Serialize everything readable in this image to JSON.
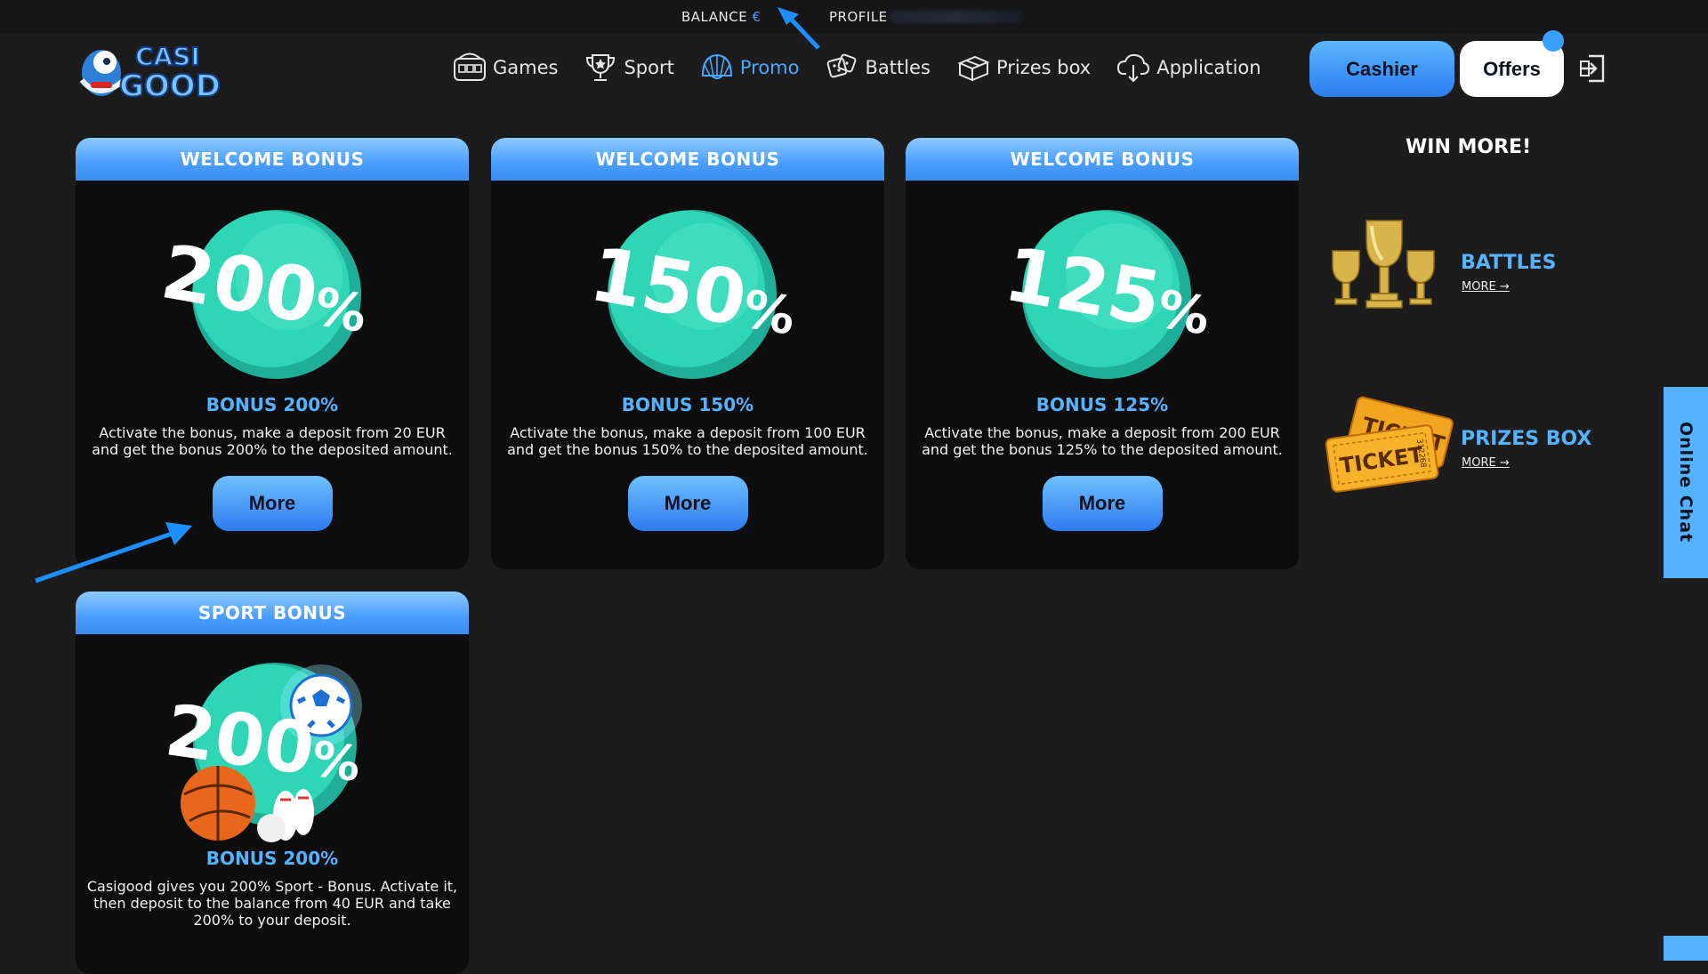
{
  "top_bar": {
    "balance_label": "BALANCE",
    "balance_currency": "€",
    "profile_label": "PROFILE"
  },
  "logo": {
    "alt": "CASI GOOD"
  },
  "nav": [
    {
      "label": "Games",
      "icon": "slot-machine-icon"
    },
    {
      "label": "Sport",
      "icon": "trophy-icon"
    },
    {
      "label": "Promo",
      "icon": "shell-icon",
      "active": true
    },
    {
      "label": "Battles",
      "icon": "dice-icon"
    },
    {
      "label": "Prizes box",
      "icon": "gift-box-icon"
    },
    {
      "label": "Application",
      "icon": "download-cloud-icon"
    }
  ],
  "header": {
    "cashier_label": "Cashier",
    "offers_label": "Offers"
  },
  "cards": [
    {
      "head": "WELCOME BONUS",
      "percent": "200",
      "title": "BONUS 200%",
      "desc_line1": "Activate the bonus, make a deposit from 20 EUR",
      "desc_line2": "and get the bonus 200% to the deposited amount.",
      "button": "More"
    },
    {
      "head": "WELCOME BONUS",
      "percent": "150",
      "title": "BONUS 150%",
      "desc_line1": "Activate the bonus, make a deposit from 100 EUR",
      "desc_line2": "and get the bonus 150% to the deposited amount.",
      "button": "More"
    },
    {
      "head": "WELCOME BONUS",
      "percent": "125",
      "title": "BONUS 125%",
      "desc_line1": "Activate the bonus, make a deposit from 200 EUR",
      "desc_line2": "and get the bonus 125% to the deposited amount.",
      "button": "More"
    },
    {
      "head": "SPORT BONUS",
      "percent": "200",
      "title": "BONUS 200%",
      "desc_line1": "Casigood gives you 200% Sport - Bonus. Activate it,",
      "desc_line2": "then deposit to the balance from 40 EUR and take",
      "desc_line3": "200% to your deposit."
    }
  ],
  "percent_sign": "%",
  "win_more": {
    "title": "WIN MORE!",
    "items": [
      {
        "name": "BATTLES",
        "more": "MORE"
      },
      {
        "name": "PRIZES BOX",
        "more": "MORE"
      }
    ],
    "ticket_text": "TICKET",
    "ticket_number": "312268"
  },
  "online_chat": "Online Chat",
  "colors": {
    "accent": "#4aa8ff",
    "teal": "#2fd6b5",
    "card_bg": "#0d0d0d",
    "page_bg": "#1c1c1c"
  }
}
